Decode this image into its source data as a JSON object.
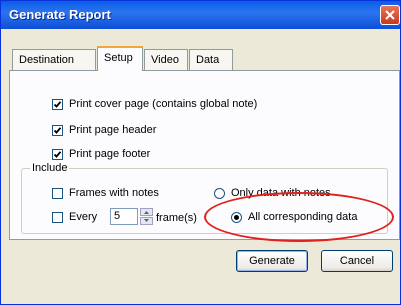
{
  "window": {
    "title": "Generate Report"
  },
  "tabs": [
    {
      "label": "Destination"
    },
    {
      "label": "Setup"
    },
    {
      "label": "Video"
    },
    {
      "label": "Data"
    }
  ],
  "setup": {
    "options": [
      {
        "label": "Print cover page (contains global note)",
        "checked": true
      },
      {
        "label": "Print page header",
        "checked": true
      },
      {
        "label": "Print page footer",
        "checked": true
      }
    ],
    "include": {
      "label": "Include",
      "frames_with_notes": {
        "label": "Frames with notes",
        "checked": false
      },
      "every": {
        "label": "Every",
        "value": "5",
        "suffix": "frame(s)",
        "checked": false
      },
      "only_data_with_notes": {
        "label": "Only data with notes",
        "selected": false
      },
      "all_corresponding_data": {
        "label": "All corresponding data",
        "selected": true
      }
    }
  },
  "buttons": {
    "generate": "Generate",
    "cancel": "Cancel"
  },
  "colors": {
    "title_bar": "#0a5de8",
    "highlight": "#e0211c",
    "check": "#1d9b1d"
  }
}
